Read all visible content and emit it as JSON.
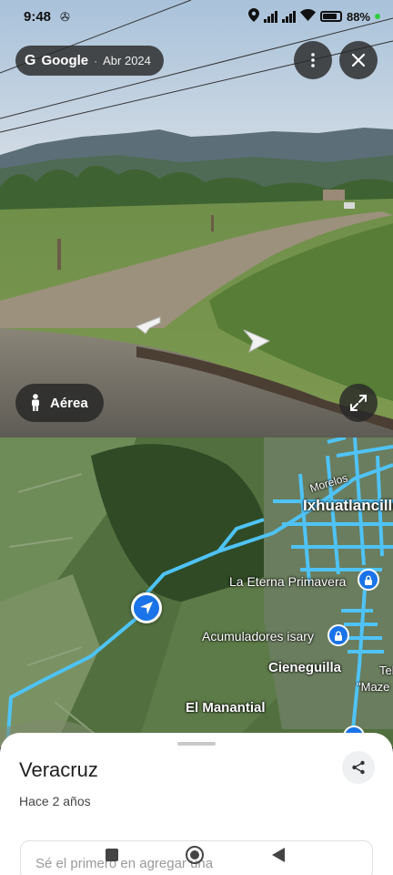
{
  "status_bar": {
    "time": "9:48",
    "battery_percent": "88%"
  },
  "streetview": {
    "brand": "Google",
    "date": "Abr 2024",
    "aerial_label": "Aérea"
  },
  "map": {
    "labels": {
      "morelos": "Morelos",
      "ixhuatlancillo": "Ixhuatlancillo",
      "eterna_primavera": "La Eterna Primavera",
      "acumuladores": "Acumuladores isary",
      "cieneguilla": "Cieneguilla",
      "tele": "Tele",
      "maze": "\"Maze",
      "el_manantial": "El Manantial"
    }
  },
  "sheet": {
    "title": "Veracruz",
    "subtitle": "Hace 2 años",
    "review_placeholder": "Sé el primero en agregar una"
  },
  "colors": {
    "route_blue": "#4fc3f7",
    "pin_blue": "#1a73e8",
    "overlay": "#282828"
  }
}
